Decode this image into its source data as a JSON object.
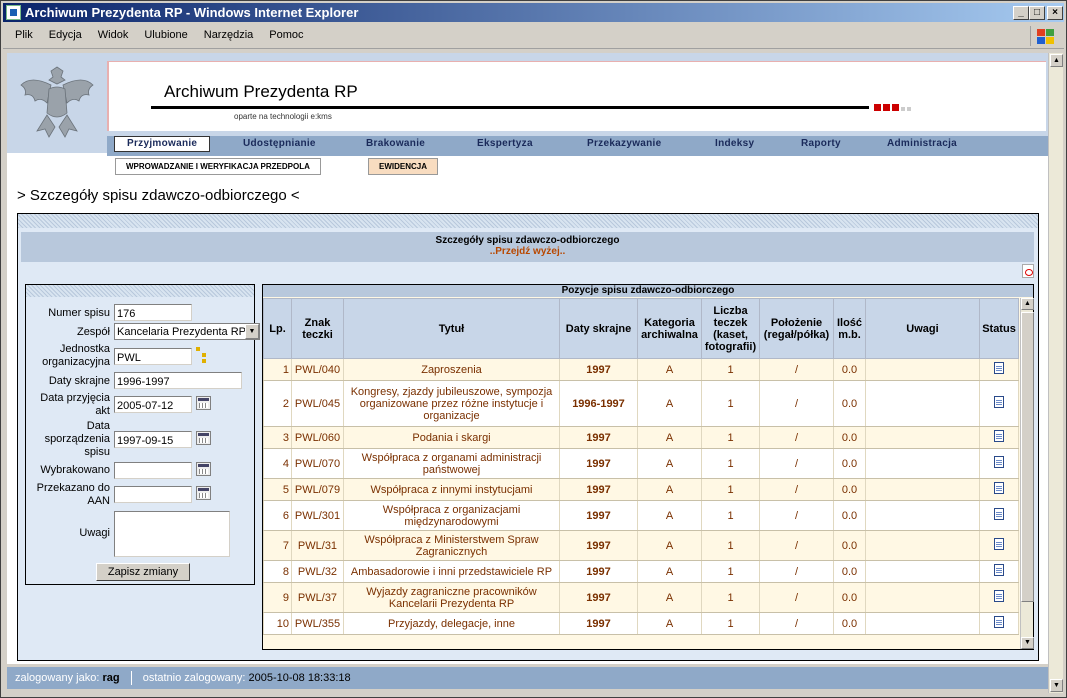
{
  "window": {
    "title": "Archiwum Prezydenta RP - Windows Internet Explorer"
  },
  "menu": [
    "Plik",
    "Edycja",
    "Widok",
    "Ulubione",
    "Narzędzia",
    "Pomoc"
  ],
  "banner": {
    "title": "Archiwum Prezydenta RP",
    "subtitle": "oparte na technologii e:kms"
  },
  "nav": [
    "Przyjmowanie",
    "Udostępnianie",
    "Brakowanie",
    "Ekspertyza",
    "Przekazywanie",
    "Indeksy",
    "Raporty",
    "Administracja"
  ],
  "subnav": [
    "WPROWADZANIE I WERYFIKACJA PRZEDPOLA",
    "EWIDENCJA"
  ],
  "page": {
    "heading": "> Szczegóły spisu zdawczo-odbiorczego <"
  },
  "details": {
    "title": "Szczegóły spisu zdawczo-odbiorczego",
    "up_link": "..Przejdź wyżej.."
  },
  "form": {
    "numer_label": "Numer spisu",
    "numer_value": "176",
    "zespol_label": "Zespół",
    "zespol_value": "Kancelaria Prezydenta RP",
    "jednostka_label": "Jednostka organizacyjna",
    "jednostka_value": "PWL",
    "daty_label": "Daty skrajne",
    "daty_value": "1996-1997",
    "przyjecia_label": "Data przyjęcia akt",
    "przyjecia_value": "2005-07-12",
    "sporzadzenia_label": "Data sporządzenia spisu",
    "sporzadzenia_value": "1997-09-15",
    "wybrakowano_label": "Wybrakowano",
    "wybrakowano_value": "",
    "przekazano_label": "Przekazano do AAN",
    "przekazano_value": "",
    "uwagi_label": "Uwagi",
    "uwagi_value": "",
    "save_label": "Zapisz zmiany"
  },
  "table": {
    "title": "Pozycje spisu zdawczo-odbiorczego",
    "headers": [
      "Lp.",
      "Znak teczki",
      "Tytuł",
      "Daty skrajne",
      "Kategoria archiwalna",
      "Liczba teczek (kaset, fotografii)",
      "Położenie (regał/półka)",
      "Ilość m.b.",
      "Uwagi",
      "Status"
    ],
    "rows": [
      {
        "lp": "1",
        "znak": "PWL/040",
        "tytul": "Zaproszenia",
        "daty": "1997",
        "kat": "A",
        "liczba": "1",
        "pol": "/",
        "ilosc": "0.0",
        "uwagi": ""
      },
      {
        "lp": "2",
        "znak": "PWL/045",
        "tytul": "Kongresy, zjazdy jubileuszowe, sympozja organizowane przez różne instytucje i organizacje",
        "daty": "1996-1997",
        "kat": "A",
        "liczba": "1",
        "pol": "/",
        "ilosc": "0.0",
        "uwagi": ""
      },
      {
        "lp": "3",
        "znak": "PWL/060",
        "tytul": "Podania i skargi",
        "daty": "1997",
        "kat": "A",
        "liczba": "1",
        "pol": "/",
        "ilosc": "0.0",
        "uwagi": ""
      },
      {
        "lp": "4",
        "znak": "PWL/070",
        "tytul": "Współpraca z organami administracji państwowej",
        "daty": "1997",
        "kat": "A",
        "liczba": "1",
        "pol": "/",
        "ilosc": "0.0",
        "uwagi": ""
      },
      {
        "lp": "5",
        "znak": "PWL/079",
        "tytul": "Współpraca z innymi instytucjami",
        "daty": "1997",
        "kat": "A",
        "liczba": "1",
        "pol": "/",
        "ilosc": "0.0",
        "uwagi": ""
      },
      {
        "lp": "6",
        "znak": "PWL/301",
        "tytul": "Współpraca z organizacjami międzynarodowymi",
        "daty": "1997",
        "kat": "A",
        "liczba": "1",
        "pol": "/",
        "ilosc": "0.0",
        "uwagi": ""
      },
      {
        "lp": "7",
        "znak": "PWL/31",
        "tytul": "Współpraca z Ministerstwem Spraw Zagranicznych",
        "daty": "1997",
        "kat": "A",
        "liczba": "1",
        "pol": "/",
        "ilosc": "0.0",
        "uwagi": ""
      },
      {
        "lp": "8",
        "znak": "PWL/32",
        "tytul": "Ambasadorowie i inni przedstawiciele RP",
        "daty": "1997",
        "kat": "A",
        "liczba": "1",
        "pol": "/",
        "ilosc": "0.0",
        "uwagi": ""
      },
      {
        "lp": "9",
        "znak": "PWL/37",
        "tytul": "Wyjazdy zagraniczne pracowników Kancelarii Prezydenta RP",
        "daty": "1997",
        "kat": "A",
        "liczba": "1",
        "pol": "/",
        "ilosc": "0.0",
        "uwagi": ""
      },
      {
        "lp": "10",
        "znak": "PWL/355",
        "tytul": "Przyjazdy, delegacje, inne",
        "daty": "1997",
        "kat": "A",
        "liczba": "1",
        "pol": "/",
        "ilosc": "0.0",
        "uwagi": ""
      }
    ]
  },
  "footer": {
    "logged_as_label": "zalogowany jako:",
    "user": "rag",
    "last_login_label": "ostatnio zalogowany:",
    "last_login": "2005-10-08 18:33:18"
  }
}
